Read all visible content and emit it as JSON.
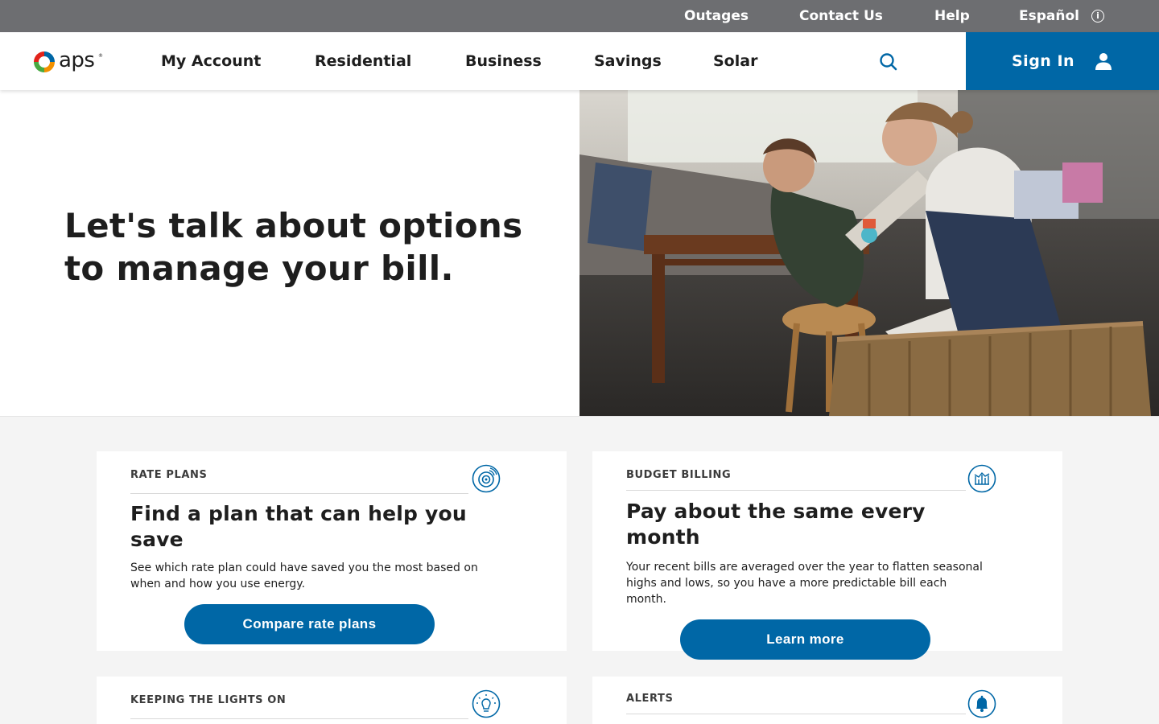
{
  "utility_nav": {
    "outages": "Outages",
    "contact": "Contact Us",
    "help": "Help",
    "language": "Español",
    "info_icon": "info-icon"
  },
  "main_nav": {
    "logo_text": "aps",
    "items": [
      {
        "label": "My Account"
      },
      {
        "label": "Residential"
      },
      {
        "label": "Business"
      },
      {
        "label": "Savings"
      },
      {
        "label": "Solar"
      }
    ],
    "search_icon": "search-icon",
    "sign_in": "Sign In",
    "user_icon": "user-icon"
  },
  "hero": {
    "title": "Let's talk about options to manage your bill.",
    "image": "mother-and-child-living-room-photo"
  },
  "cards": [
    {
      "eyebrow": "RATE PLANS",
      "icon": "rate-meter-icon",
      "title": "Find a plan that can help you save",
      "description": "See which rate plan could have saved you the most based on when and how you use energy.",
      "button": "Compare rate plans"
    },
    {
      "eyebrow": "BUDGET BILLING",
      "icon": "budget-chart-icon",
      "title": "Pay about the same every month",
      "description": "Your recent bills are averaged over the year to flatten seasonal highs and lows, so you have a more predictable bill each month.",
      "button": "Learn more"
    },
    {
      "eyebrow": "KEEPING THE LIGHTS ON",
      "icon": "lightbulb-icon"
    },
    {
      "eyebrow": "ALERTS",
      "icon": "bell-icon"
    }
  ],
  "colors": {
    "brand_blue": "#0067a6",
    "utility_bar": "#6d6e71",
    "page_bg": "#f4f4f4"
  }
}
